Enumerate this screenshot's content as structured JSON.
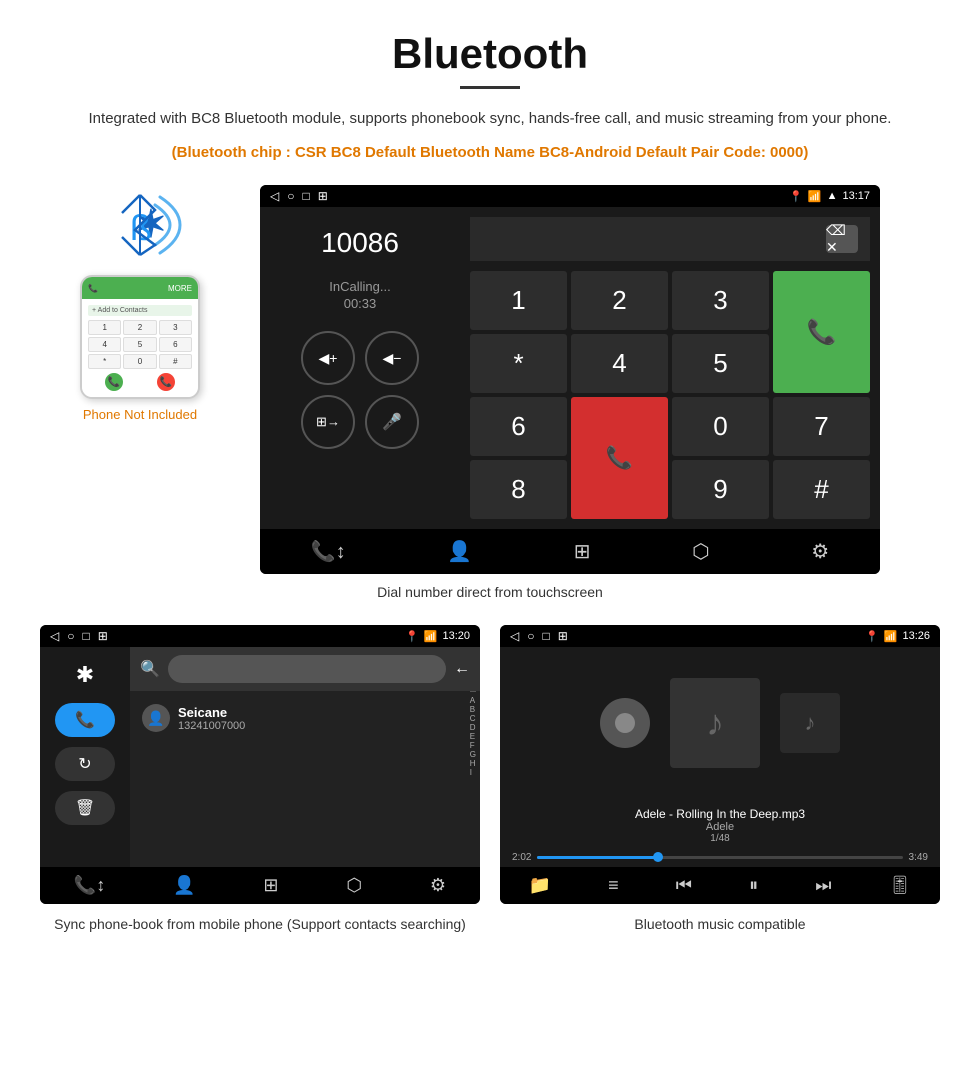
{
  "page": {
    "title": "Bluetooth",
    "intro": "Integrated with BC8 Bluetooth module, supports phonebook sync, hands-free call, and music streaming from your phone.",
    "bluetooth_info": "(Bluetooth chip : CSR BC8    Default Bluetooth Name BC8-Android    Default Pair Code: 0000)",
    "dial_caption": "Dial number direct from touchscreen",
    "phone_not_included": "Phone Not Included",
    "phonebook_caption": "Sync phone-book from mobile phone\n(Support contacts searching)",
    "music_caption": "Bluetooth music compatible"
  },
  "dial_screen": {
    "status_time": "13:17",
    "number": "10086",
    "call_status": "InCalling...",
    "call_timer": "00:33",
    "keypad": [
      "1",
      "2",
      "3",
      "*",
      "4",
      "5",
      "6",
      "0",
      "7",
      "8",
      "9",
      "#"
    ]
  },
  "phonebook_screen": {
    "status_time": "13:20",
    "contact_name": "Seicane",
    "contact_number": "13241007000",
    "alpha_letters": [
      "A",
      "B",
      "C",
      "D",
      "E",
      "F",
      "G",
      "H",
      "I"
    ]
  },
  "music_screen": {
    "status_time": "13:26",
    "song_title": "Adele - Rolling In the Deep.mp3",
    "artist": "Adele",
    "track_counter": "1/48",
    "time_current": "2:02",
    "time_total": "3:49",
    "progress_percent": 33
  },
  "icons": {
    "bluetooth": "✱",
    "phone_call": "📞",
    "back_arrow": "◁",
    "home": "○",
    "recents": "□",
    "apps": "⊞",
    "contacts": "👤",
    "keypad": "⋮⋮⋮",
    "share": "⬡",
    "settings": "⚙",
    "search": "🔍",
    "arrow_left": "←",
    "shuffle": "⇌",
    "prev": "⏮",
    "play_pause": "⏸",
    "next": "⏭",
    "equalizer": "≡",
    "folder": "📁",
    "list": "≡",
    "phone_sync": "📞↕",
    "delete": "🗑",
    "refresh": "↻",
    "volume_up": "◀+",
    "volume_down": "◀−",
    "switch": "⊞→",
    "mic": "🎤",
    "backspace": "⌫",
    "green_phone": "📞",
    "red_phone": "📞"
  }
}
